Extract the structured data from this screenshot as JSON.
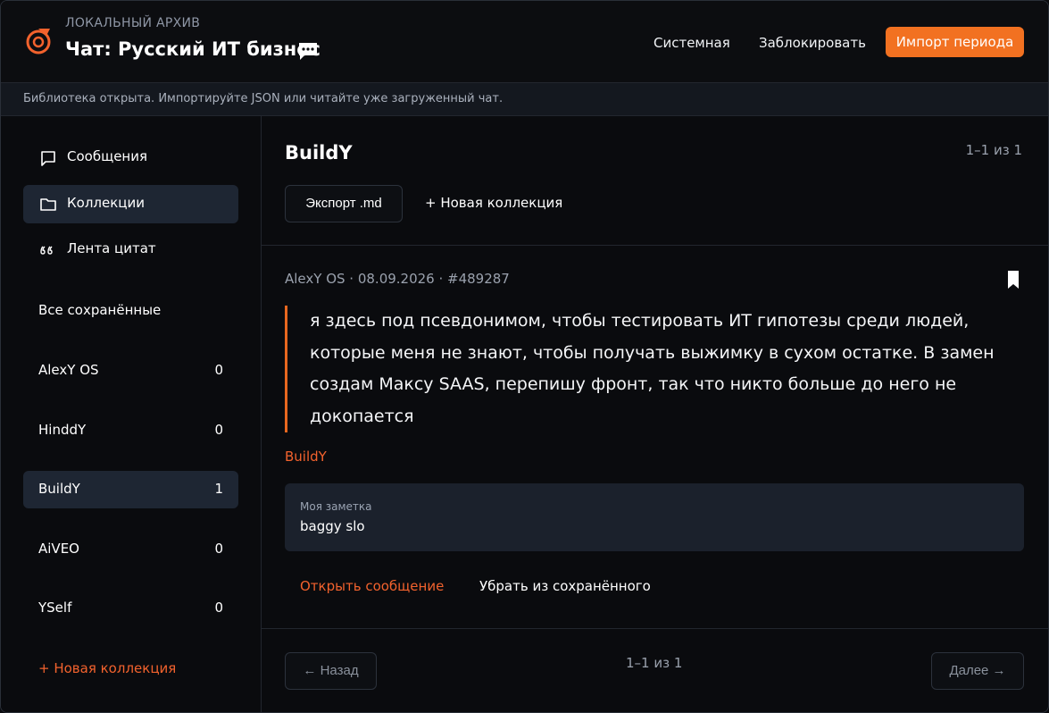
{
  "header": {
    "archive_label": "ЛОКАЛЬНЫЙ АРХИВ",
    "chat_title": "Чат: Русский ИТ бизнес",
    "chat_icon": "chat-bubble-icon",
    "buttons": {
      "system": "Системная",
      "lock": "Заблокировать",
      "import": "Импорт периода"
    },
    "accent_color": "#f27121"
  },
  "status_bar": {
    "text": "Библиотека открыта. Импортируйте JSON или читайте уже загруженный чат."
  },
  "sidebar": {
    "nav": [
      {
        "label": "Сообщения",
        "icon": "message-square-icon",
        "active": false
      },
      {
        "label": "Коллекции",
        "icon": "folder-icon",
        "active": true
      },
      {
        "label": "Лента цитат",
        "icon": "quote-icon",
        "active": false
      }
    ],
    "collections": [
      {
        "label": "Все сохранённые",
        "count": ""
      },
      {
        "label": "AlexY OS",
        "count": "0"
      },
      {
        "label": "HinddY",
        "count": "0"
      },
      {
        "label": "BuildY",
        "count": "1",
        "active": true
      },
      {
        "label": "AiVEO",
        "count": "0"
      },
      {
        "label": "YSelf",
        "count": "0"
      }
    ],
    "new_collection": "+ Новая коллекция"
  },
  "main": {
    "title": "BuildY",
    "page_count": "1–1 из 1",
    "export_label": "Экспорт .md",
    "new_collection": "+ Новая коллекция",
    "message": {
      "meta": "AlexY OS · 08.09.2026 · #489287",
      "text": "я здесь под псевдонимом, чтобы тестировать ИТ гипотезы среди людей, которые меня не знают, чтобы получать выжимку в сухом остатке. В замен создам Максу SAAS, перепишу фронт, так что никто больше до него не докопается",
      "tag": "BuildY",
      "note_label": "Моя заметка",
      "note_text": "baggy slo",
      "open_label": "Открыть сообщение",
      "remove_label": "Убрать из сохранённого"
    },
    "pagination": {
      "back": "← Назад",
      "count": "1–1 из 1",
      "next": "Далее →"
    }
  }
}
